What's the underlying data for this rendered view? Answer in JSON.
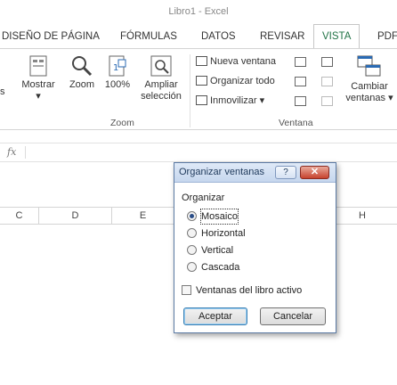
{
  "window": {
    "title": "Libro1 - Excel"
  },
  "tabs": [
    {
      "label": "DISEÑO DE PÁGINA"
    },
    {
      "label": "FÓRMULAS"
    },
    {
      "label": "DATOS"
    },
    {
      "label": "REVISAR"
    },
    {
      "label": "VISTA"
    },
    {
      "label": "PDF"
    }
  ],
  "ribbon": {
    "cut_label": "s",
    "mostrar": "Mostrar",
    "zoom": "Zoom",
    "zoom100": "100%",
    "ampliar_line1": "Ampliar",
    "ampliar_line2": "selección",
    "zoom_group": "Zoom",
    "nueva_ventana": "Nueva ventana",
    "organizar_todo": "Organizar todo",
    "inmovilizar": "Inmovilizar",
    "ventana_group": "Ventana",
    "cambiar_line1": "Cambiar",
    "cambiar_line2": "ventanas"
  },
  "formula_bar": {
    "fx": "fx"
  },
  "columns": [
    "C",
    "D",
    "E",
    "H"
  ],
  "dialog": {
    "title": "Organizar ventanas",
    "help": "?",
    "close": "✕",
    "section": "Organizar",
    "options": [
      {
        "label": "Mosaico",
        "selected": true
      },
      {
        "label": "Horizontal",
        "selected": false
      },
      {
        "label": "Vertical",
        "selected": false
      },
      {
        "label": "Cascada",
        "selected": false
      }
    ],
    "checkbox_label": "Ventanas del libro activo",
    "checkbox_checked": false,
    "ok": "Aceptar",
    "cancel": "Cancelar"
  },
  "colors": {
    "accent": "#217346",
    "dialog_border": "#5b7aa4",
    "close": "#c7432e"
  }
}
